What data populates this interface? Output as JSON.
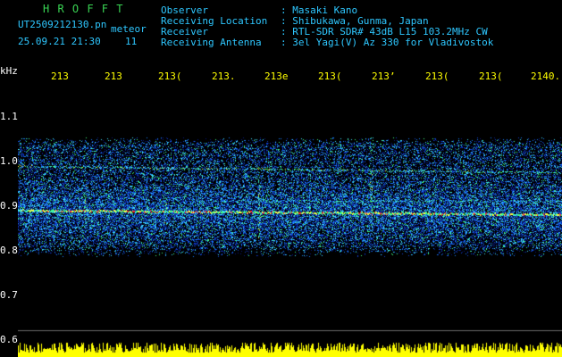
{
  "header": {
    "brand": "H R O F F T",
    "filename": "UT2509212130.pn",
    "meteor_label": "meteor",
    "datetime": "25.09.21 21:30",
    "count": "11"
  },
  "info": {
    "labels": [
      "Observer",
      "Receiving Location",
      "Receiver",
      "Receiving Antenna"
    ],
    "values": [
      ": Masaki Kano",
      ": Shibukawa, Gunma, Japan",
      ": RTL-SDR SDR# 43dB L15 103.2MHz CW",
      ": 3el Yagi(V) Az 330 for Vladivostok"
    ]
  },
  "axis": {
    "unit": "kHz",
    "time_ticks": [
      "213",
      "213",
      "213(",
      "213.",
      "213е",
      "213(",
      "213’",
      "213(",
      "213(",
      "2140."
    ],
    "freq_ticks": [
      "1.1",
      "1.0",
      "0.9",
      "0.8",
      "0.7",
      "0.6"
    ]
  },
  "colors": {
    "background": "#000000",
    "brand": "#39d353",
    "info_text": "#2ec7ff",
    "axis_text": "#ffff00",
    "meteor_burst": "#ffff00"
  }
}
